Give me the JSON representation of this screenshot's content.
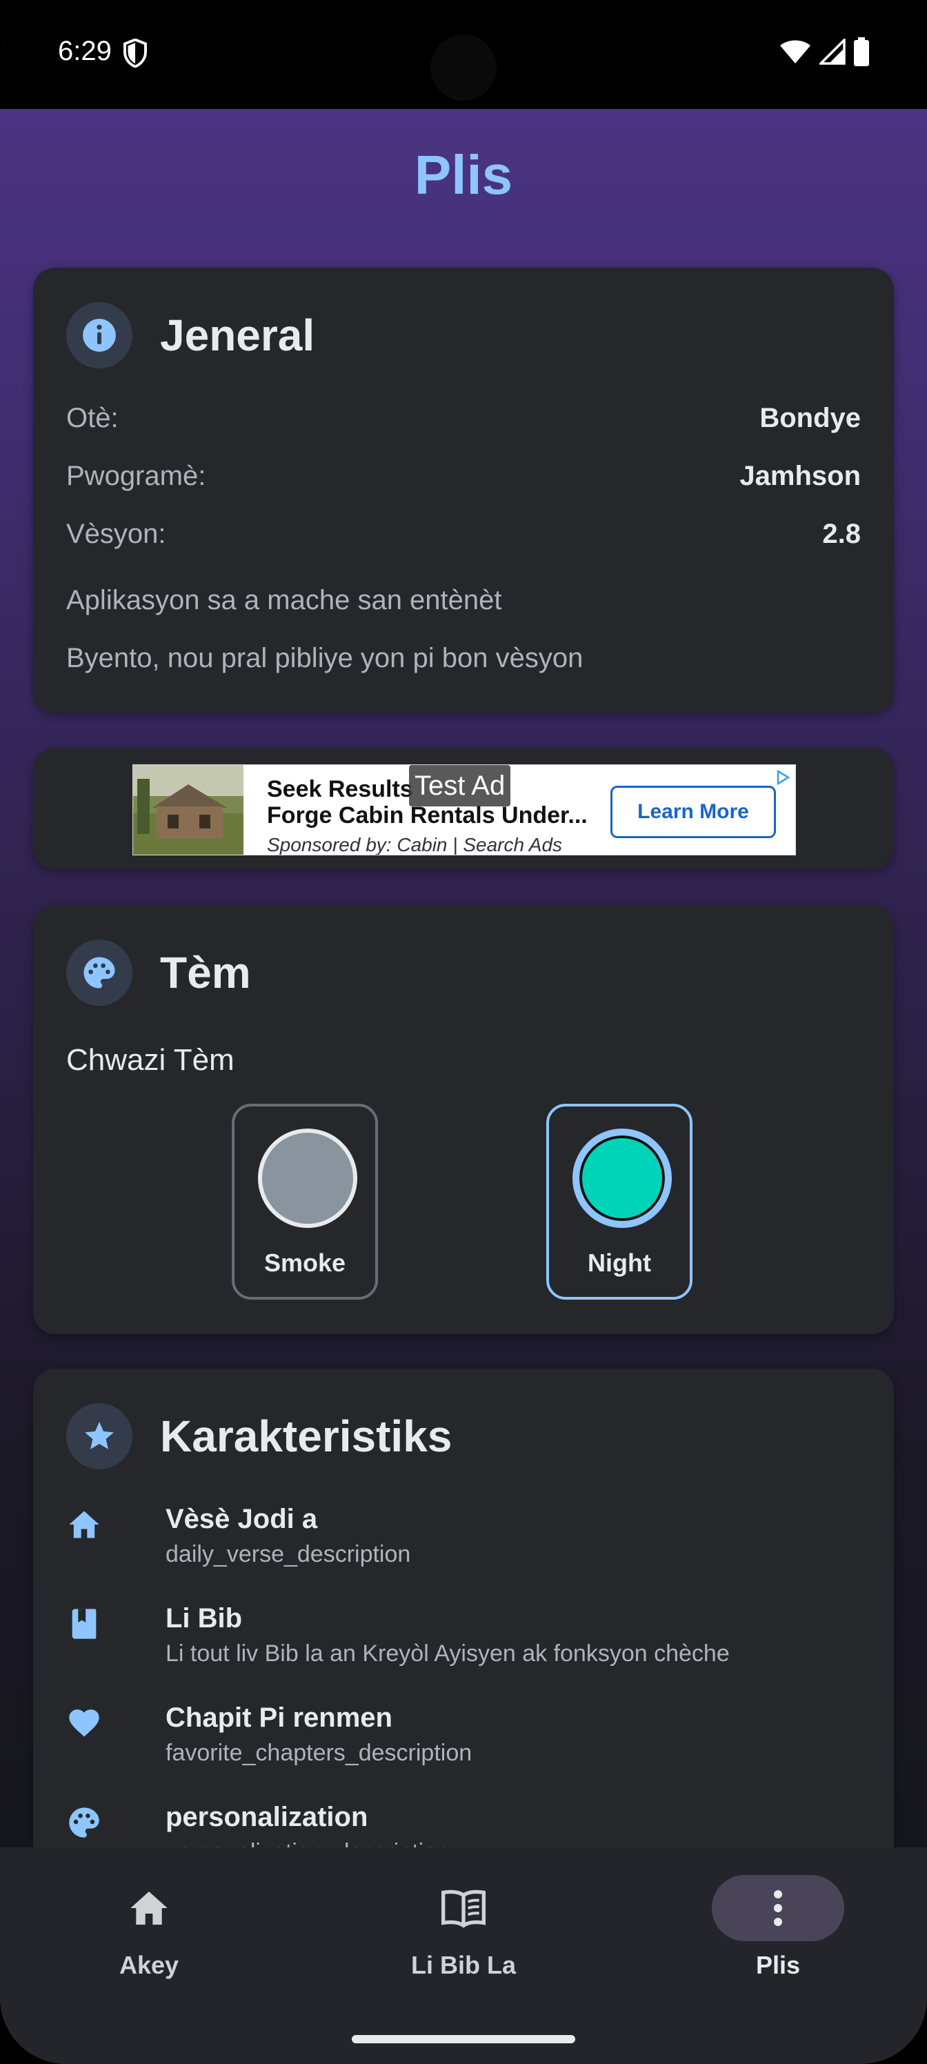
{
  "status_bar": {
    "time": "6:29"
  },
  "page_title": "Plis",
  "general": {
    "title": "Jeneral",
    "rows": [
      {
        "label": "Otè:",
        "value": "Bondye"
      },
      {
        "label": "Pwogramè:",
        "value": "Jamhson"
      },
      {
        "label": "Vèsyon:",
        "value": "2.8"
      }
    ],
    "notes": [
      "Aplikasyon sa a mache san entènèt",
      "Byento, nou pral pibliye yon pi bon vèsyon"
    ]
  },
  "ad": {
    "headline1": "Seek Results",
    "headline2": "Forge Cabin Rentals Under...",
    "sponsor": "Sponsored by: Cabin | Search Ads",
    "test_label": "Test Ad",
    "button": "Learn More"
  },
  "theme": {
    "title": "Tèm",
    "subtitle": "Chwazi Tèm",
    "options": [
      {
        "name": "Smoke",
        "color": "#8a949e",
        "selected": false
      },
      {
        "name": "Night",
        "color": "#00d4b8",
        "selected": true
      }
    ]
  },
  "features": {
    "title": "Karakteristiks",
    "items": [
      {
        "icon": "home-icon",
        "title": "Vèsè Jodi a",
        "description": "daily_verse_description"
      },
      {
        "icon": "book-icon",
        "title": "Li Bib",
        "description": "Li tout liv Bib la an Kreyòl Ayisyen ak fonksyon chèche"
      },
      {
        "icon": "heart-icon",
        "title": "Chapit Pi renmen",
        "description": "favorite_chapters_description"
      },
      {
        "icon": "palette-icon",
        "title": "personalization",
        "description": "personalization_description"
      }
    ]
  },
  "nav": {
    "items": [
      {
        "label": "Akey",
        "icon": "home-icon",
        "active": false
      },
      {
        "label": "Li Bib La",
        "icon": "book-open-icon",
        "active": false
      },
      {
        "label": "Plis",
        "icon": "more-vertical-icon",
        "active": true
      }
    ]
  },
  "colors": {
    "accent": "#8ec5ff",
    "card": "#25272b",
    "selected_border": "#8ec5ff"
  }
}
